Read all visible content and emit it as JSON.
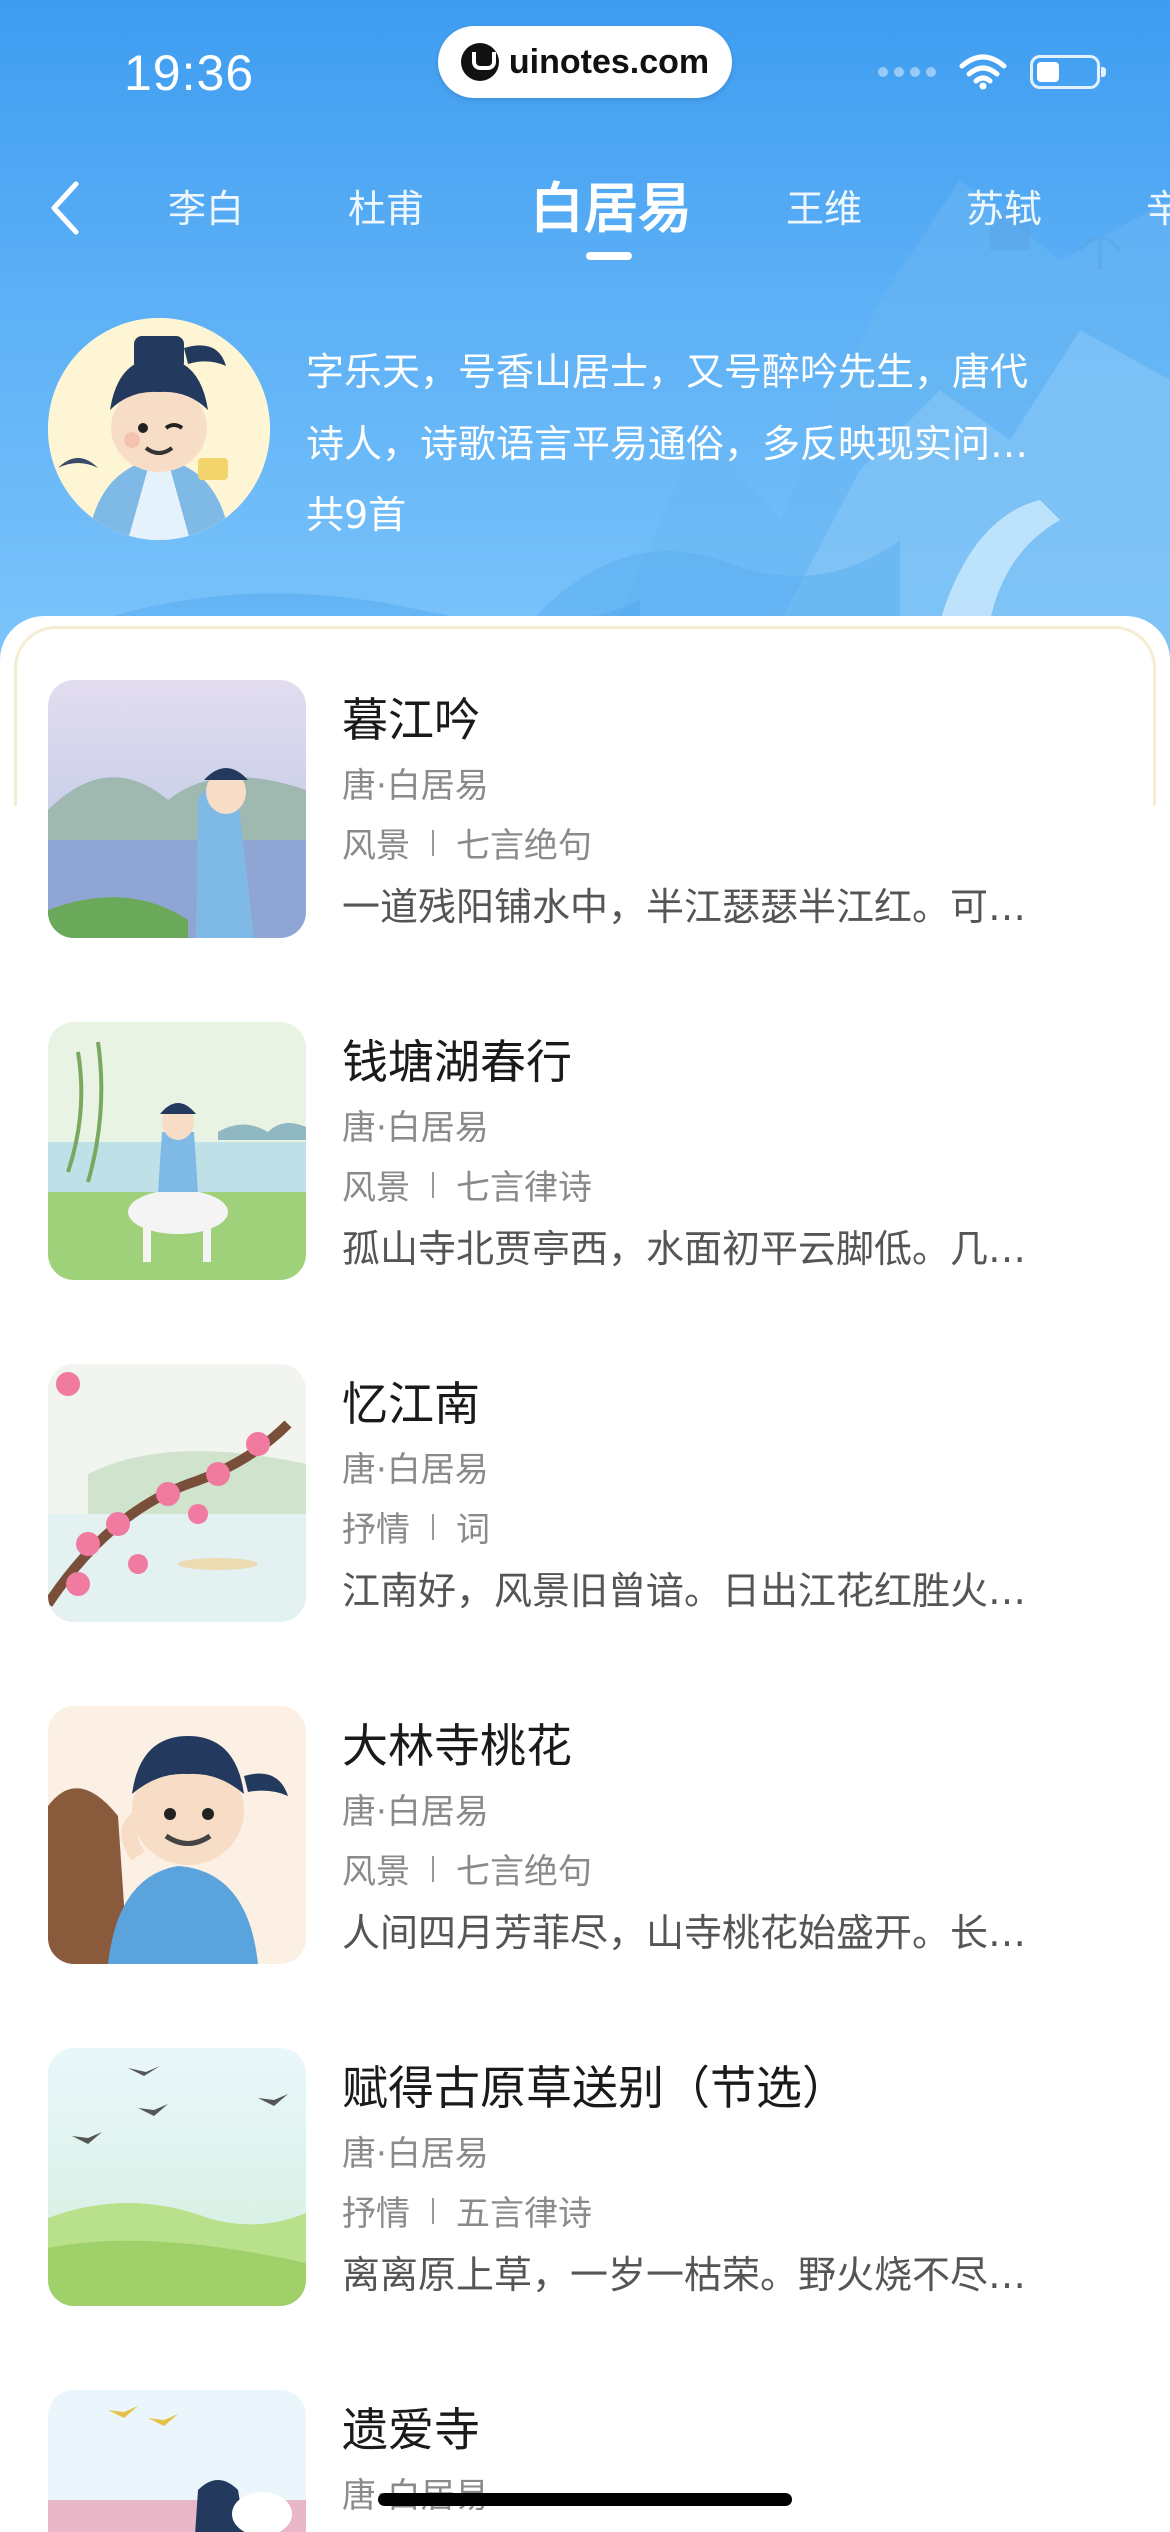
{
  "status_bar": {
    "time": "19:36",
    "url": "uinotes.com"
  },
  "nav": {
    "back_icon": "chevron-left-icon",
    "tabs": [
      {
        "label": "李白"
      },
      {
        "label": "杜甫"
      },
      {
        "label": "白居易",
        "active": true
      },
      {
        "label": "王维"
      },
      {
        "label": "苏轼"
      },
      {
        "label": "辛"
      }
    ]
  },
  "poet": {
    "intro_line1": "字乐天，号香山居士，又号醉吟先生，唐代",
    "intro_line2": "诗人，诗歌语言平易通俗，多反映现实问…",
    "count": "共9首"
  },
  "poems": [
    {
      "title": "暮江吟",
      "author": "唐·白居易",
      "theme": "风景",
      "form": "七言绝句",
      "excerpt": "一道残阳铺水中，半江瑟瑟半江红。可…"
    },
    {
      "title": "钱塘湖春行",
      "author": "唐·白居易",
      "theme": "风景",
      "form": "七言律诗",
      "excerpt": "孤山寺北贾亭西，水面初平云脚低。几…"
    },
    {
      "title": "忆江南",
      "author": "唐·白居易",
      "theme": "抒情",
      "form": "词",
      "excerpt": "江南好，风景旧曾谙。日出江花红胜火…"
    },
    {
      "title": "大林寺桃花",
      "author": "唐·白居易",
      "theme": "风景",
      "form": "七言绝句",
      "excerpt": "人间四月芳菲尽，山寺桃花始盛开。长…"
    },
    {
      "title": "赋得古原草送别（节选）",
      "author": "唐·白居易",
      "theme": "抒情",
      "form": "五言律诗",
      "excerpt": "离离原上草，一岁一枯荣。野火烧不尽…"
    },
    {
      "title": "遗爱寺",
      "author": "唐·白居易"
    }
  ],
  "colors": {
    "header_blue": "#4fa8f3",
    "title_text": "#1a1a1a",
    "meta_text": "#8a8a8a"
  }
}
